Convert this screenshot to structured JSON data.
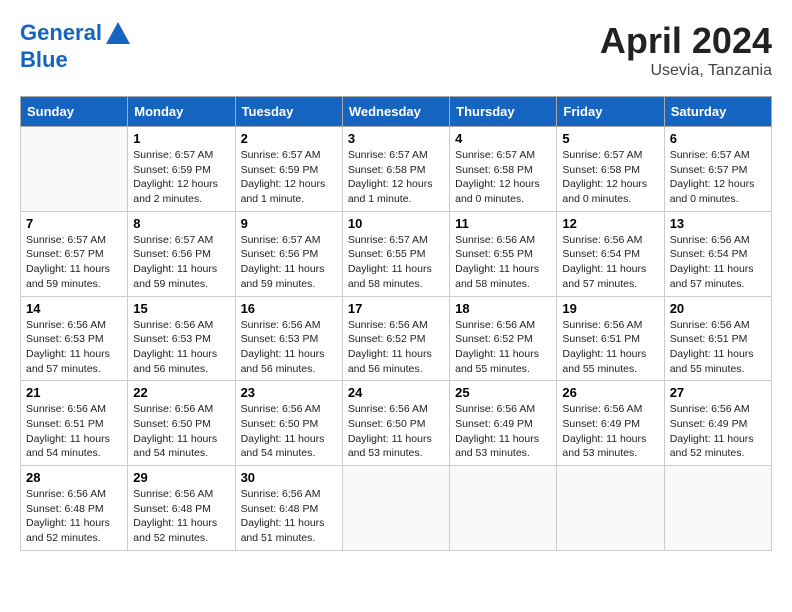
{
  "header": {
    "logo_line1": "General",
    "logo_line2": "Blue",
    "month_year": "April 2024",
    "location": "Usevia, Tanzania"
  },
  "weekdays": [
    "Sunday",
    "Monday",
    "Tuesday",
    "Wednesday",
    "Thursday",
    "Friday",
    "Saturday"
  ],
  "weeks": [
    [
      {
        "day": "",
        "info": ""
      },
      {
        "day": "1",
        "info": "Sunrise: 6:57 AM\nSunset: 6:59 PM\nDaylight: 12 hours\nand 2 minutes."
      },
      {
        "day": "2",
        "info": "Sunrise: 6:57 AM\nSunset: 6:59 PM\nDaylight: 12 hours\nand 1 minute."
      },
      {
        "day": "3",
        "info": "Sunrise: 6:57 AM\nSunset: 6:58 PM\nDaylight: 12 hours\nand 1 minute."
      },
      {
        "day": "4",
        "info": "Sunrise: 6:57 AM\nSunset: 6:58 PM\nDaylight: 12 hours\nand 0 minutes."
      },
      {
        "day": "5",
        "info": "Sunrise: 6:57 AM\nSunset: 6:58 PM\nDaylight: 12 hours\nand 0 minutes."
      },
      {
        "day": "6",
        "info": "Sunrise: 6:57 AM\nSunset: 6:57 PM\nDaylight: 12 hours\nand 0 minutes."
      }
    ],
    [
      {
        "day": "7",
        "info": "Sunrise: 6:57 AM\nSunset: 6:57 PM\nDaylight: 11 hours\nand 59 minutes."
      },
      {
        "day": "8",
        "info": "Sunrise: 6:57 AM\nSunset: 6:56 PM\nDaylight: 11 hours\nand 59 minutes."
      },
      {
        "day": "9",
        "info": "Sunrise: 6:57 AM\nSunset: 6:56 PM\nDaylight: 11 hours\nand 59 minutes."
      },
      {
        "day": "10",
        "info": "Sunrise: 6:57 AM\nSunset: 6:55 PM\nDaylight: 11 hours\nand 58 minutes."
      },
      {
        "day": "11",
        "info": "Sunrise: 6:56 AM\nSunset: 6:55 PM\nDaylight: 11 hours\nand 58 minutes."
      },
      {
        "day": "12",
        "info": "Sunrise: 6:56 AM\nSunset: 6:54 PM\nDaylight: 11 hours\nand 57 minutes."
      },
      {
        "day": "13",
        "info": "Sunrise: 6:56 AM\nSunset: 6:54 PM\nDaylight: 11 hours\nand 57 minutes."
      }
    ],
    [
      {
        "day": "14",
        "info": "Sunrise: 6:56 AM\nSunset: 6:53 PM\nDaylight: 11 hours\nand 57 minutes."
      },
      {
        "day": "15",
        "info": "Sunrise: 6:56 AM\nSunset: 6:53 PM\nDaylight: 11 hours\nand 56 minutes."
      },
      {
        "day": "16",
        "info": "Sunrise: 6:56 AM\nSunset: 6:53 PM\nDaylight: 11 hours\nand 56 minutes."
      },
      {
        "day": "17",
        "info": "Sunrise: 6:56 AM\nSunset: 6:52 PM\nDaylight: 11 hours\nand 56 minutes."
      },
      {
        "day": "18",
        "info": "Sunrise: 6:56 AM\nSunset: 6:52 PM\nDaylight: 11 hours\nand 55 minutes."
      },
      {
        "day": "19",
        "info": "Sunrise: 6:56 AM\nSunset: 6:51 PM\nDaylight: 11 hours\nand 55 minutes."
      },
      {
        "day": "20",
        "info": "Sunrise: 6:56 AM\nSunset: 6:51 PM\nDaylight: 11 hours\nand 55 minutes."
      }
    ],
    [
      {
        "day": "21",
        "info": "Sunrise: 6:56 AM\nSunset: 6:51 PM\nDaylight: 11 hours\nand 54 minutes."
      },
      {
        "day": "22",
        "info": "Sunrise: 6:56 AM\nSunset: 6:50 PM\nDaylight: 11 hours\nand 54 minutes."
      },
      {
        "day": "23",
        "info": "Sunrise: 6:56 AM\nSunset: 6:50 PM\nDaylight: 11 hours\nand 54 minutes."
      },
      {
        "day": "24",
        "info": "Sunrise: 6:56 AM\nSunset: 6:50 PM\nDaylight: 11 hours\nand 53 minutes."
      },
      {
        "day": "25",
        "info": "Sunrise: 6:56 AM\nSunset: 6:49 PM\nDaylight: 11 hours\nand 53 minutes."
      },
      {
        "day": "26",
        "info": "Sunrise: 6:56 AM\nSunset: 6:49 PM\nDaylight: 11 hours\nand 53 minutes."
      },
      {
        "day": "27",
        "info": "Sunrise: 6:56 AM\nSunset: 6:49 PM\nDaylight: 11 hours\nand 52 minutes."
      }
    ],
    [
      {
        "day": "28",
        "info": "Sunrise: 6:56 AM\nSunset: 6:48 PM\nDaylight: 11 hours\nand 52 minutes."
      },
      {
        "day": "29",
        "info": "Sunrise: 6:56 AM\nSunset: 6:48 PM\nDaylight: 11 hours\nand 52 minutes."
      },
      {
        "day": "30",
        "info": "Sunrise: 6:56 AM\nSunset: 6:48 PM\nDaylight: 11 hours\nand 51 minutes."
      },
      {
        "day": "",
        "info": ""
      },
      {
        "day": "",
        "info": ""
      },
      {
        "day": "",
        "info": ""
      },
      {
        "day": "",
        "info": ""
      }
    ]
  ]
}
